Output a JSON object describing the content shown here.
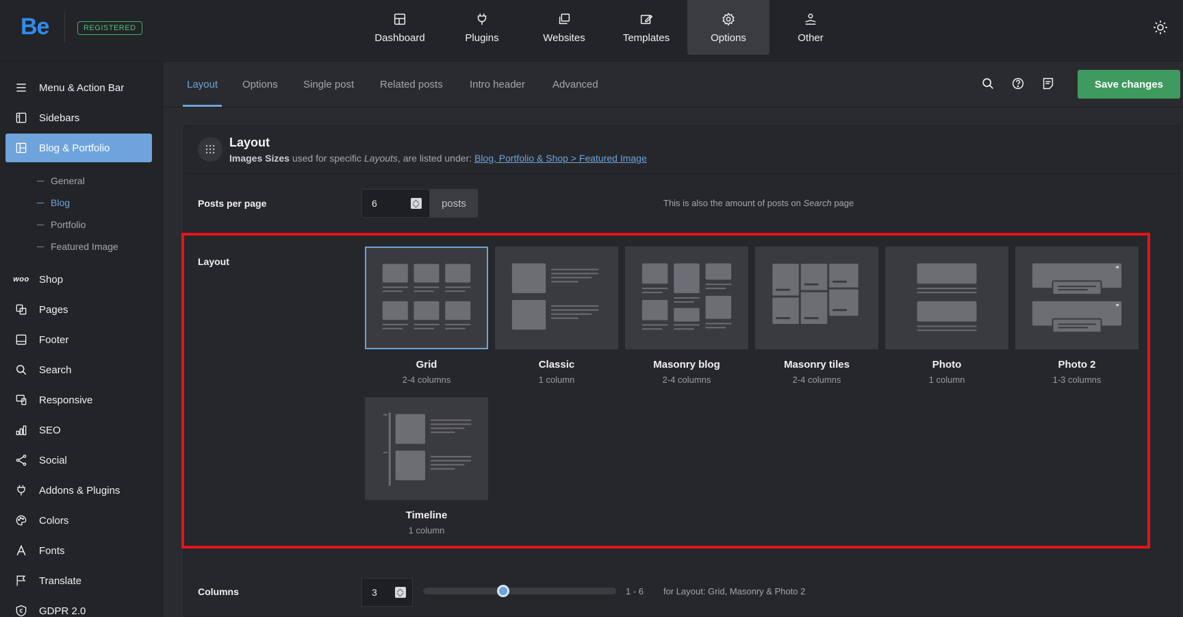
{
  "header": {
    "logo": "Be",
    "badge": "REGISTERED",
    "nav": [
      {
        "label": "Dashboard",
        "icon": "dashboard-icon"
      },
      {
        "label": "Plugins",
        "icon": "plug-icon"
      },
      {
        "label": "Websites",
        "icon": "websites-icon"
      },
      {
        "label": "Templates",
        "icon": "templates-icon"
      },
      {
        "label": "Options",
        "icon": "gear-icon",
        "active": true
      },
      {
        "label": "Other",
        "icon": "user-hand-icon"
      }
    ]
  },
  "sidebar": {
    "items": [
      {
        "label": "Menu & Action Bar",
        "icon": "menu-icon"
      },
      {
        "label": "Sidebars",
        "icon": "sidebar-icon"
      },
      {
        "label": "Blog & Portfolio",
        "icon": "layout-icon",
        "active": true
      },
      {
        "label": "Shop",
        "icon": "woo-icon"
      },
      {
        "label": "Pages",
        "icon": "pages-icon"
      },
      {
        "label": "Footer",
        "icon": "footer-icon"
      },
      {
        "label": "Search",
        "icon": "search-icon"
      },
      {
        "label": "Responsive",
        "icon": "responsive-icon"
      },
      {
        "label": "SEO",
        "icon": "seo-icon"
      },
      {
        "label": "Social",
        "icon": "share-icon"
      },
      {
        "label": "Addons & Plugins",
        "icon": "plug-icon"
      },
      {
        "label": "Colors",
        "icon": "palette-icon"
      },
      {
        "label": "Fonts",
        "icon": "font-icon"
      },
      {
        "label": "Translate",
        "icon": "flag-icon"
      },
      {
        "label": "GDPR 2.0",
        "icon": "gdpr-icon"
      }
    ],
    "woo_text": "woo",
    "subitems": [
      {
        "label": "General"
      },
      {
        "label": "Blog",
        "active": true
      },
      {
        "label": "Portfolio"
      },
      {
        "label": "Featured Image"
      }
    ]
  },
  "subtabs": [
    "Layout",
    "Options",
    "Single post",
    "Related posts",
    "Intro header",
    "Advanced"
  ],
  "toolbar": {
    "save_label": "Save changes"
  },
  "panel": {
    "title": "Layout",
    "desc_bold": "Images Sizes",
    "desc_mid": " used for specific ",
    "desc_italic": "Layouts",
    "desc_end": ", are listed under: ",
    "desc_link": "Blog, Portfolio & Shop > Featured Image"
  },
  "posts_per_page": {
    "label": "Posts per page",
    "value": "6",
    "suffix": "posts",
    "note_start": "This is also the amount of posts on ",
    "note_italic": "Search",
    "note_end": " page"
  },
  "layout": {
    "label": "Layout",
    "options": [
      {
        "title": "Grid",
        "sub": "2-4 columns",
        "selected": true
      },
      {
        "title": "Classic",
        "sub": "1 column"
      },
      {
        "title": "Masonry blog",
        "sub": "2-4 columns"
      },
      {
        "title": "Masonry tiles",
        "sub": "2-4 columns"
      },
      {
        "title": "Photo",
        "sub": "1 column"
      },
      {
        "title": "Photo 2",
        "sub": "1-3 columns"
      },
      {
        "title": "Timeline",
        "sub": "1 column"
      }
    ]
  },
  "columns": {
    "label": "Columns",
    "value": "3",
    "range": "1 - 6",
    "slider_value": 3,
    "slider_min": 1,
    "slider_max": 6,
    "note": "for Layout: Grid, Masonry & Photo 2"
  },
  "colors": {
    "accent": "#6ea4db",
    "save": "#3f9a5f",
    "highlight": "#e4141a"
  }
}
